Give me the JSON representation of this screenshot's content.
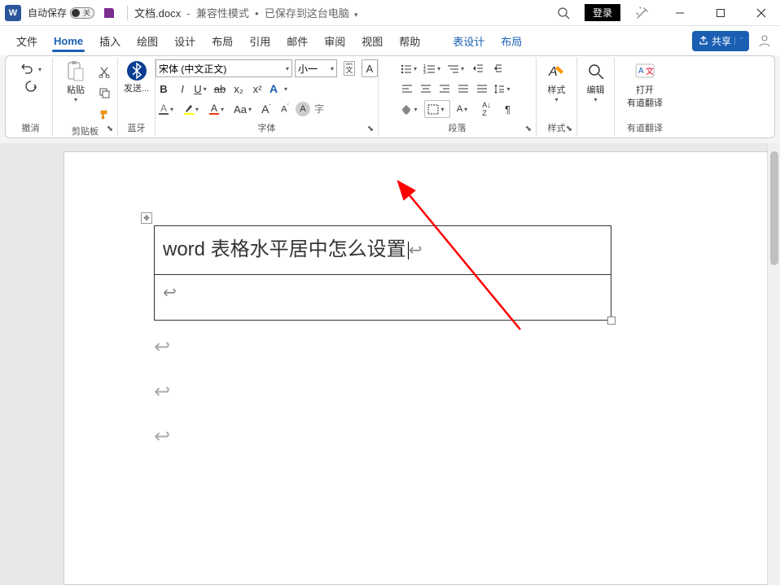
{
  "titlebar": {
    "autosave_label": "自动保存",
    "autosave_state": "关",
    "doc_name": "文档.docx",
    "doc_subtitle": "兼容性模式",
    "save_status": "已保存到这台电脑",
    "signin": "登录"
  },
  "tabs": {
    "file": "文件",
    "home": "Home",
    "insert": "插入",
    "draw": "绘图",
    "design": "设计",
    "layout": "布局",
    "references": "引用",
    "mail": "邮件",
    "review": "审阅",
    "view": "视图",
    "help": "帮助",
    "table_design": "表设计",
    "table_layout": "布局",
    "share": "共享"
  },
  "ribbon": {
    "undo_label": "撤消",
    "clipboard_label": "剪贴板",
    "paste_label": "粘贴",
    "bluetooth_label": "蓝牙",
    "bt_send": "发送...",
    "font_label": "字体",
    "font_name": "宋体 (中文正文)",
    "font_size": "小一",
    "paragraph_label": "段落",
    "styles_label": "样式",
    "styles_btn": "样式",
    "edit_label": "编辑",
    "youdao_label": "有道翻译",
    "youdao_open": "打开",
    "youdao_open_sub": "有道翻译",
    "wen_label": "文",
    "b": "B",
    "i": "I",
    "u": "U",
    "x2": "x₂",
    "x2sup": "x²",
    "aa": "Aa",
    "a_plus": "A",
    "a_minus": "A"
  },
  "doc": {
    "cell_text": "word 表格水平居中怎么设置"
  }
}
